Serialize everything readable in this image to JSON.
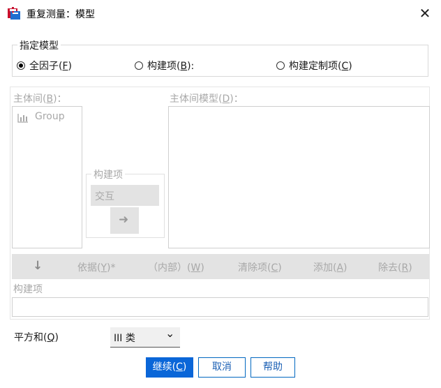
{
  "window": {
    "title": "重复测量：模型",
    "close_glyph": "✕"
  },
  "specify_model": {
    "legend": "指定模型",
    "options": [
      {
        "label": "全因子(",
        "mnemonic": "F",
        "suffix": ")",
        "checked": true
      },
      {
        "label": "构建项(",
        "mnemonic": "B",
        "suffix": "):",
        "checked": false
      },
      {
        "label": "构建定制项(",
        "mnemonic": "C",
        "suffix": ")",
        "checked": false
      }
    ]
  },
  "between_subjects": {
    "label": "主体间(",
    "mnemonic": "B",
    "suffix": ")：",
    "items": [
      {
        "name": "Group",
        "icon": "scale-icon"
      }
    ]
  },
  "between_model": {
    "label": "主体间模型(",
    "mnemonic": "D",
    "suffix": ")："
  },
  "build_terms_group": {
    "legend": "构建项",
    "type_value": "交互",
    "move_arrow": "➜"
  },
  "toolbar": {
    "down_arrow": "↓",
    "by": "依据(",
    "by_m": "Y",
    "by_s": ")*",
    "within": "（内部）(",
    "within_m": "W",
    "within_s": ")",
    "clear": "清除项(",
    "clear_m": "C",
    "clear_s": ")",
    "add": "添加(",
    "add_m": "A",
    "add_s": ")",
    "remove": "除去(",
    "remove_m": "R",
    "remove_s": ")"
  },
  "build_term": {
    "label": "构建项"
  },
  "sum_of_squares": {
    "label": "平方和(",
    "mnemonic": "Q",
    "suffix": ")",
    "value": "III 类",
    "chevron": "⌄"
  },
  "buttons": {
    "continue": "继续(",
    "continue_m": "C",
    "continue_s": ")",
    "cancel": "取消",
    "help": "帮助"
  },
  "colors": {
    "accent": "#0a66d8",
    "disabled_text": "#a8a8a8"
  }
}
